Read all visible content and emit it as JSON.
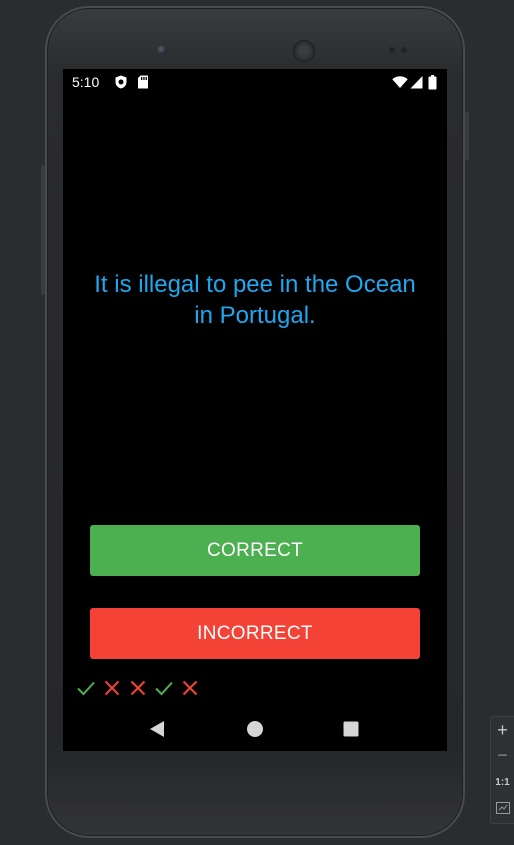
{
  "status_bar": {
    "time": "5:10",
    "left_icons": [
      "shield-icon",
      "sd-card-icon"
    ],
    "right_icons": [
      "wifi-icon",
      "cellular-signal-icon",
      "battery-icon"
    ]
  },
  "question": {
    "text": "It is illegal to pee in the Ocean in Portugal.",
    "color": "#1ea8f0"
  },
  "buttons": {
    "correct_label": "CORRECT",
    "correct_color": "#4caf50",
    "incorrect_label": "INCORRECT",
    "incorrect_color": "#f44336"
  },
  "score_history": [
    {
      "result": "correct",
      "icon": "check-icon",
      "color": "#4caf50"
    },
    {
      "result": "incorrect",
      "icon": "cross-icon",
      "color": "#f44336"
    },
    {
      "result": "incorrect",
      "icon": "cross-icon",
      "color": "#f44336"
    },
    {
      "result": "correct",
      "icon": "check-icon",
      "color": "#4caf50"
    },
    {
      "result": "incorrect",
      "icon": "cross-icon",
      "color": "#f44336"
    }
  ],
  "nav_bar": {
    "items": [
      "back-icon",
      "home-icon",
      "recents-icon"
    ]
  },
  "zoom_controls": {
    "zoom_in": "+",
    "zoom_out": "−",
    "actual_size": "1:1",
    "fit_icon": "fit-screen-icon"
  }
}
